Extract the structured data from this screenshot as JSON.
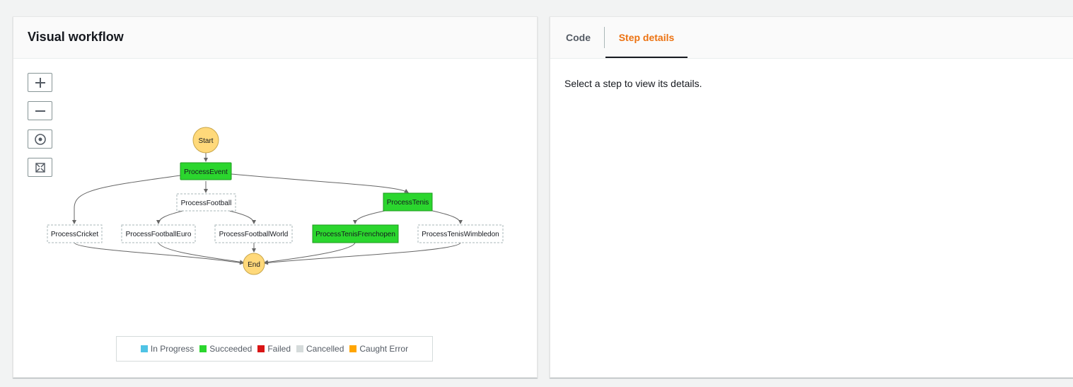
{
  "workflow": {
    "title": "Visual workflow",
    "zoom_controls": [
      {
        "name": "zoom-in-button",
        "icon": "plus-icon"
      },
      {
        "name": "zoom-out-button",
        "icon": "minus-icon"
      },
      {
        "name": "center-button",
        "icon": "target-icon"
      },
      {
        "name": "fit-view-button",
        "icon": "expand-icon"
      }
    ],
    "nodes": {
      "start": "Start",
      "process_event": "ProcessEvent",
      "process_football": "ProcessFootball",
      "process_tenis": "ProcessTenis",
      "process_cricket": "ProcessCricket",
      "process_football_euro": "ProcessFootballEuro",
      "process_football_world": "ProcessFootballWorld",
      "process_tenis_frenchopen": "ProcessTenisFrenchopen",
      "process_tenis_wimbledon": "ProcessTenisWimbledon",
      "end": "End"
    },
    "legend": [
      {
        "label": "In Progress",
        "color": "#4fc3e5"
      },
      {
        "label": "Succeeded",
        "color": "#2bd62e"
      },
      {
        "label": "Failed",
        "color": "#d91515"
      },
      {
        "label": "Cancelled",
        "color": "#d5dbdb"
      },
      {
        "label": "Caught Error",
        "color": "#ffa500"
      }
    ],
    "colors": {
      "terminal_fill": "#ffd97a",
      "succeeded_fill": "#2bd62e",
      "edge": "#666666",
      "pending_border": "#aab7b8"
    }
  },
  "details": {
    "tabs": {
      "code": "Code",
      "step_details": "Step details"
    },
    "empty_message": "Select a step to view its details."
  }
}
